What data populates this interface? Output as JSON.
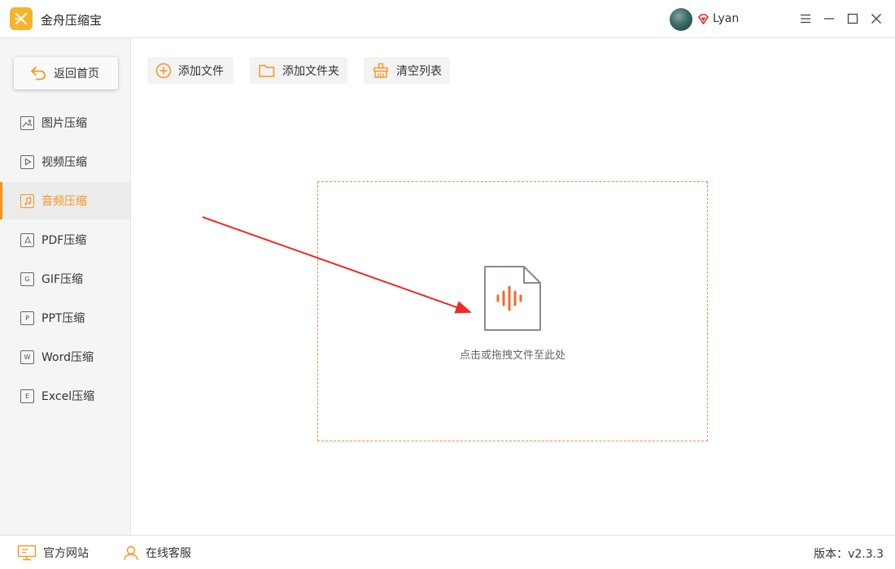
{
  "app": {
    "title": "金舟压缩宝",
    "username": "Lyan",
    "accent": "#f7931e"
  },
  "window_controls": {
    "menu_icon": "menu-icon",
    "minimize_icon": "minimize-icon",
    "maximize_icon": "maximize-icon",
    "close_icon": "close-icon"
  },
  "sidebar": {
    "home_label": "返回首页",
    "items": [
      {
        "label": "图片压缩",
        "icon": "image-icon",
        "active": false
      },
      {
        "label": "视频压缩",
        "icon": "video-icon",
        "active": false
      },
      {
        "label": "音频压缩",
        "icon": "audio-icon",
        "active": true
      },
      {
        "label": "PDF压缩",
        "icon": "pdf-icon",
        "active": false
      },
      {
        "label": "GIF压缩",
        "icon": "gif-icon",
        "active": false
      },
      {
        "label": "PPT压缩",
        "icon": "ppt-icon",
        "active": false
      },
      {
        "label": "Word压缩",
        "icon": "word-icon",
        "active": false
      },
      {
        "label": "Excel压缩",
        "icon": "excel-icon",
        "active": false
      }
    ]
  },
  "toolbar": {
    "add_file": "添加文件",
    "add_folder": "添加文件夹",
    "clear_list": "清空列表"
  },
  "dropzone": {
    "hint": "点击或拖拽文件至此处"
  },
  "footer": {
    "website": "官方网站",
    "support": "在线客服",
    "version": "版本：v2.3.3"
  }
}
